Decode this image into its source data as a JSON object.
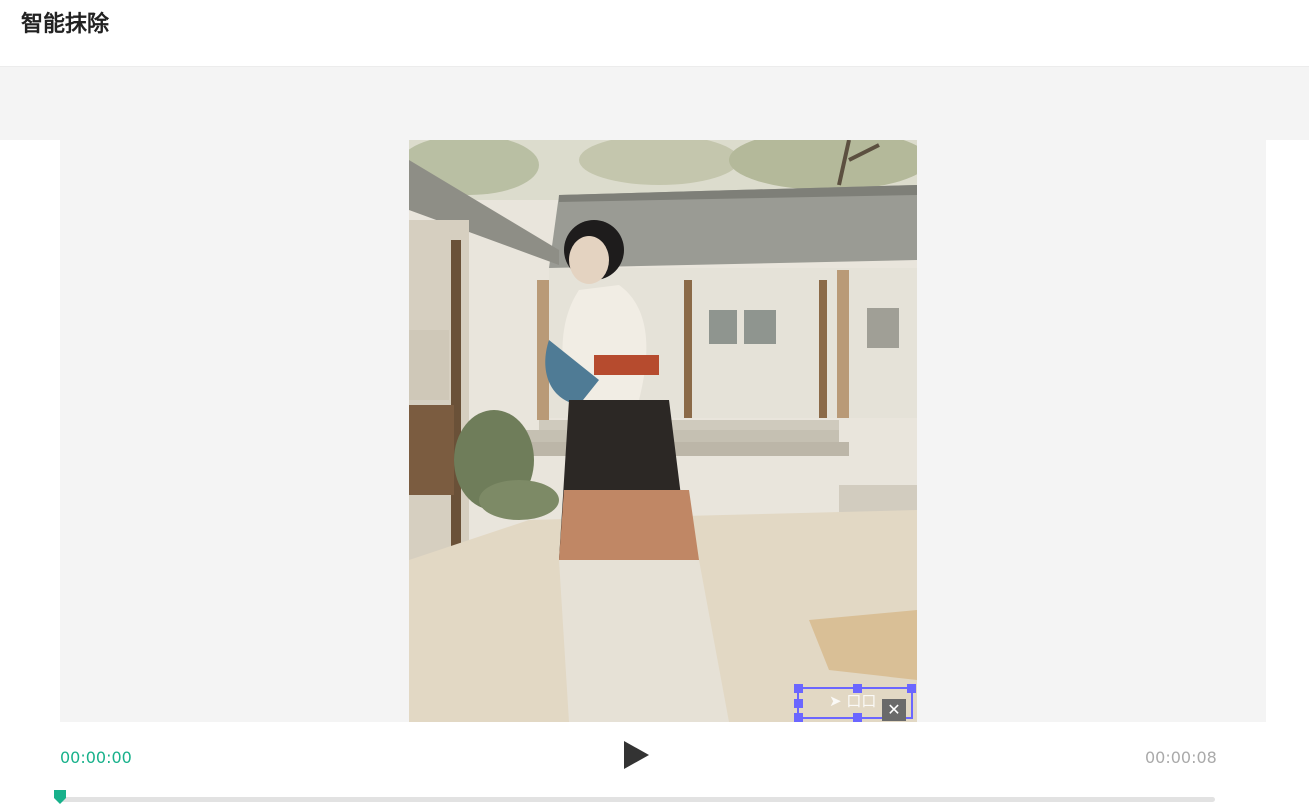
{
  "header": {
    "title": "智能抹除"
  },
  "selection": {
    "close_label": "✕",
    "close_icon": "close-icon"
  },
  "player": {
    "current_time": "00:00:00",
    "total_time": "00:00:08",
    "progress": 0,
    "play_icon": "play-icon"
  },
  "colors": {
    "accent": "#18b18b",
    "selection": "#6b66ff",
    "panel_bg": "#f4f4f4"
  }
}
